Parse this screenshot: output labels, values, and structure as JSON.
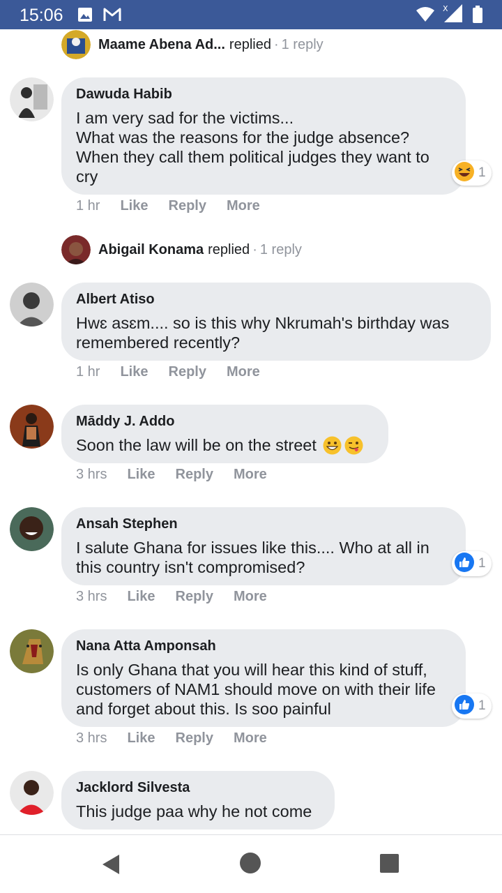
{
  "status_bar": {
    "time": "15:06",
    "icons": [
      "image-icon",
      "gmail-icon",
      "wifi-icon",
      "signal-icon",
      "battery-icon"
    ]
  },
  "reply_summaries": [
    {
      "name": "Maame Abena Ad...",
      "verb": "replied",
      "count": "1 reply"
    },
    {
      "name": "Abigail Konama",
      "verb": "replied",
      "count": "1 reply"
    }
  ],
  "comments": [
    {
      "name": "Dawuda Habib",
      "text": "I am very sad for the victims...\nWhat was the reasons for the judge absence?\nWhen they call them political judges they want to cry",
      "time": "1 hr",
      "like": "Like",
      "reply": "Reply",
      "more": "More",
      "reaction": {
        "icon": "laughing-emoji-icon",
        "count": "1"
      }
    },
    {
      "name": "Albert Atiso",
      "text": "Hwɛ asɛm.... so is this why Nkrumah's birthday was remembered recently?",
      "time": "1 hr",
      "like": "Like",
      "reply": "Reply",
      "more": "More"
    },
    {
      "name": "Māddy J. Addo",
      "text": "Soon the law will be on the street",
      "emojis": [
        "grinning-emoji-icon",
        "winking-tongue-emoji-icon"
      ],
      "time": "3 hrs",
      "like": "Like",
      "reply": "Reply",
      "more": "More"
    },
    {
      "name": "Ansah Stephen",
      "text": "I salute Ghana for issues like this.... Who at all in this country isn't compromised?",
      "time": "3 hrs",
      "like": "Like",
      "reply": "Reply",
      "more": "More",
      "reaction": {
        "icon": "thumbs-up-icon",
        "count": "1"
      }
    },
    {
      "name": "Nana Atta Amponsah",
      "text": "Is only Ghana that you will hear this kind of stuff, customers of NAM1 should move on with their life and forget about this. Is soo painful",
      "time": "3 hrs",
      "like": "Like",
      "reply": "Reply",
      "more": "More",
      "reaction": {
        "icon": "thumbs-up-icon",
        "count": "1"
      }
    },
    {
      "name": "Jacklord Silvesta",
      "text": "This judge paa why he not come"
    }
  ],
  "nav_bar": {
    "icons": [
      "back-icon",
      "home-icon",
      "recents-icon"
    ]
  },
  "colors": {
    "status_bar": "#3b5998",
    "bubble": "#e9ebee",
    "meta_text": "#90949c",
    "like_blue": "#1877f2"
  }
}
